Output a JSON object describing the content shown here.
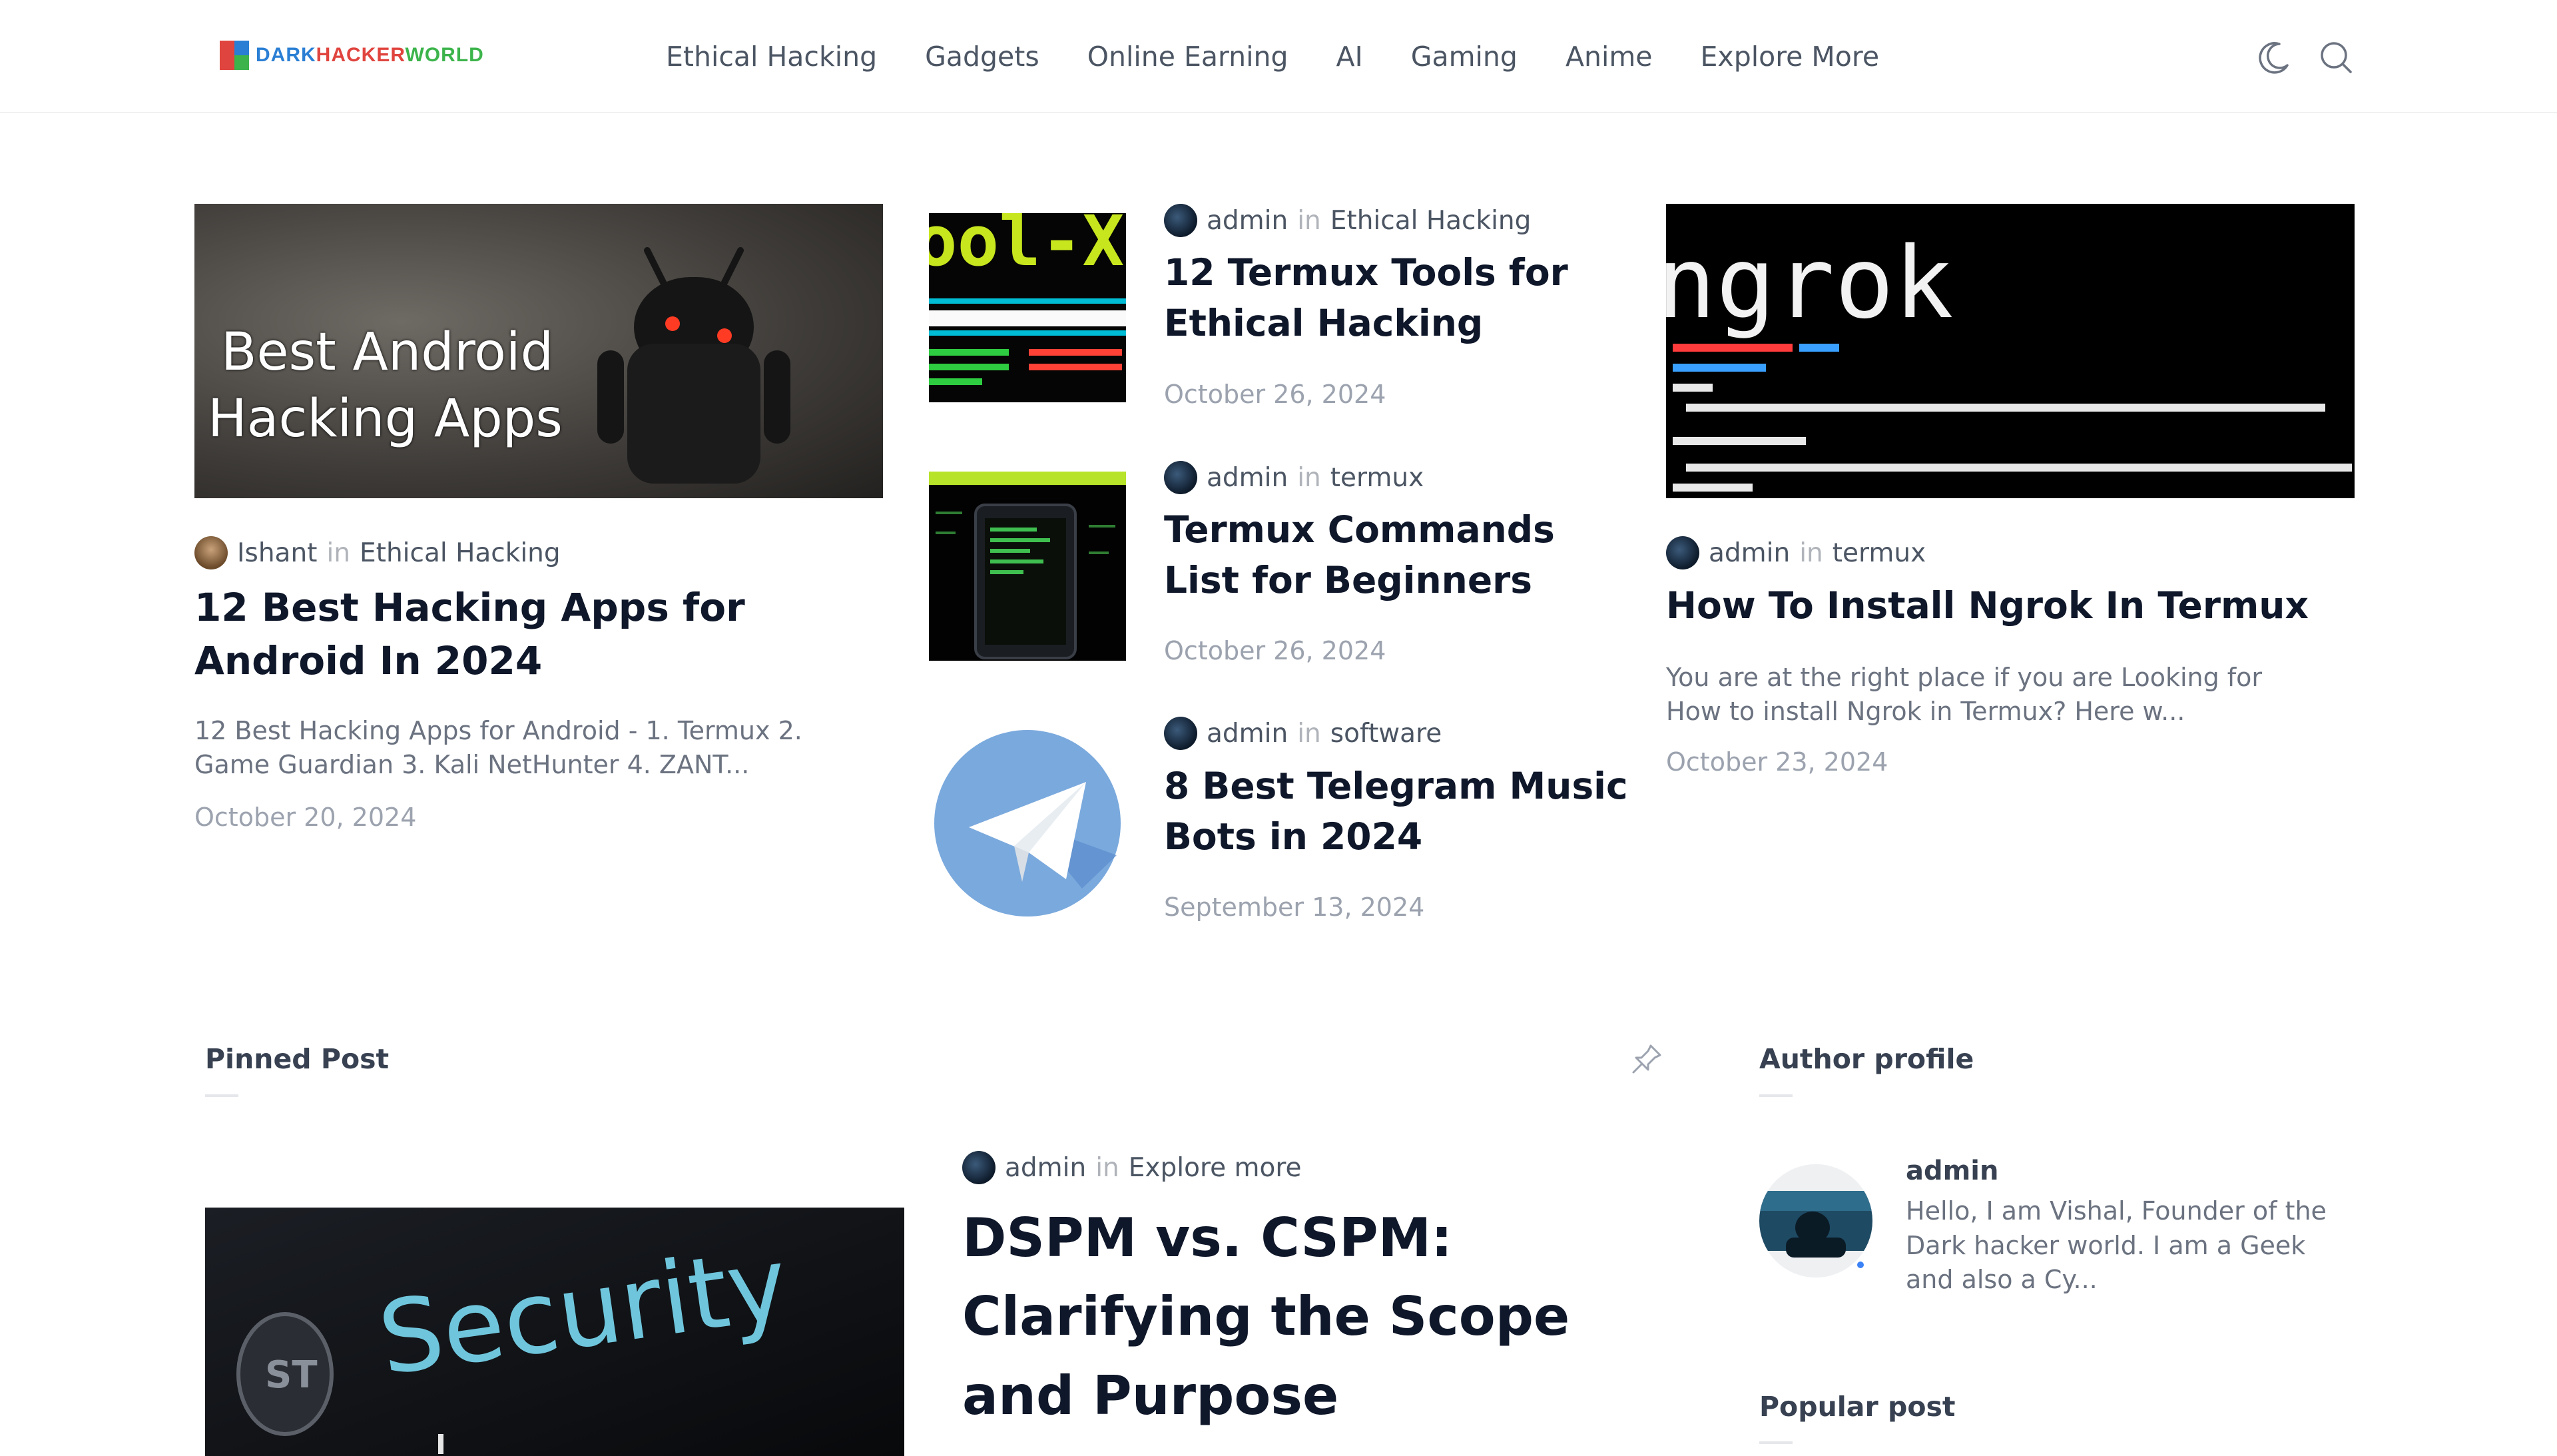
{
  "site": {
    "logo_a": "DARK",
    "logo_b": "HACKER",
    "logo_c": "WORLD"
  },
  "nav": {
    "items": [
      "Ethical Hacking",
      "Gadgets",
      "Online Earning",
      "AI",
      "Gaming",
      "Anime",
      "Explore More"
    ]
  },
  "header_icons": [
    "moon-icon",
    "search-icon"
  ],
  "featured": {
    "card1": {
      "image_line1": "Best Android",
      "image_line2": "Hacking Apps",
      "author": "Ishant",
      "in": "in",
      "category": "Ethical Hacking",
      "title": "12 Best Hacking Apps for Android In 2024",
      "excerpt": "12 Best Hacking Apps for Android - 1. Termux 2. Game Guardian 3. Kali NetHunter 4. ZANT...",
      "date": "October 20, 2024"
    },
    "list": [
      {
        "author": "admin",
        "in": "in",
        "category": "Ethical Hacking",
        "title": "12 Termux Tools for Ethical Hacking",
        "date": "October 26, 2024"
      },
      {
        "author": "admin",
        "in": "in",
        "category": "termux",
        "title": "Termux Commands List for Beginners",
        "date": "October 26, 2024"
      },
      {
        "author": "admin",
        "in": "in",
        "category": "software",
        "title": "8 Best Telegram Music Bots in 2024",
        "date": "September 13, 2024"
      }
    ],
    "card3": {
      "image_word": "ngrok",
      "author": "admin",
      "in": "in",
      "category": "termux",
      "title": "How To Install Ngrok In Termux",
      "excerpt": "You are at the right place if you are Looking for How to install Ngrok in Termux? Here w...",
      "date": "October 23, 2024"
    }
  },
  "pinned": {
    "heading": "Pinned Post",
    "image_word": "Security",
    "author": "admin",
    "in": "in",
    "category": "Explore more",
    "title": "DSPM vs. CSPM: Clarifying the Scope and Purpose"
  },
  "author_profile": {
    "heading": "Author profile",
    "name": "admin",
    "bio": "Hello, I am Vishal, Founder of the Dark hacker world. I am a Geek and also a Cy..."
  },
  "popular": {
    "heading": "Popular post"
  },
  "colors": {
    "text_dark": "#0f172a",
    "text_meta": "#4b5563",
    "text_muted": "#9ca3af",
    "logo_blue": "#2a7fd4",
    "logo_red": "#e0443e",
    "logo_green": "#3cb44b"
  }
}
